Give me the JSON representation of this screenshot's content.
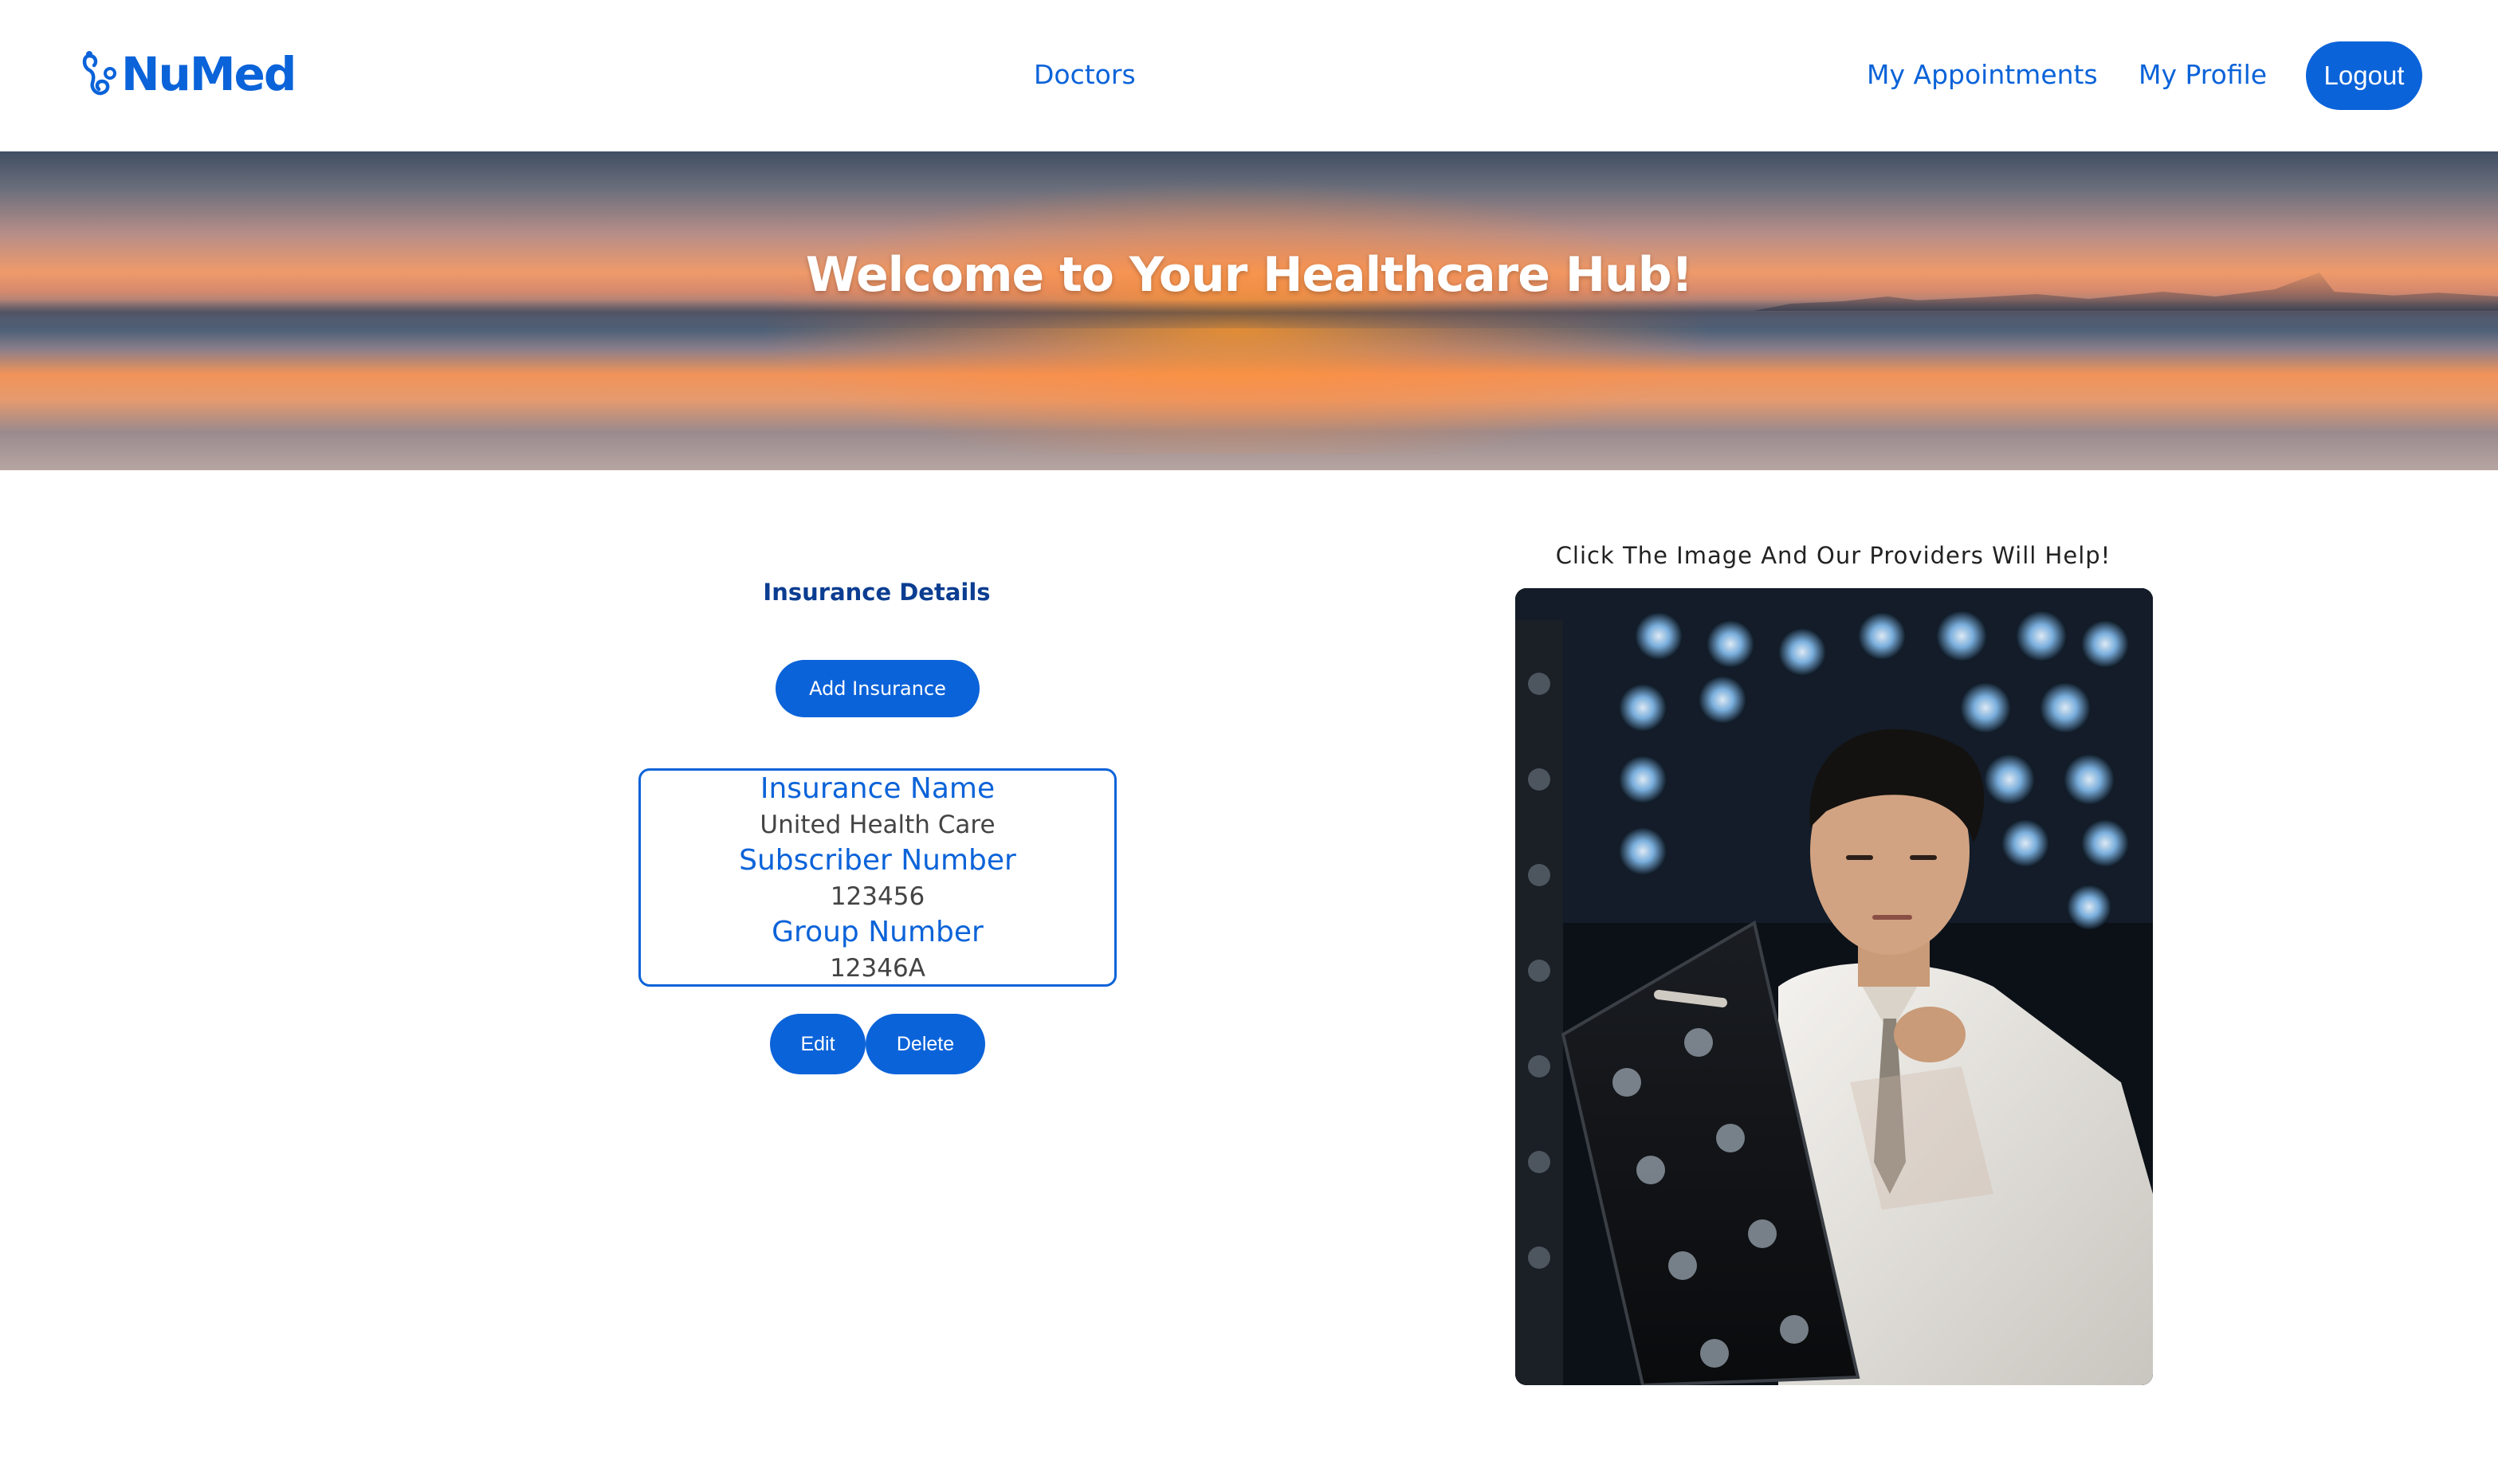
{
  "brand": {
    "name": "NuMed",
    "accent_color": "#0b63d9",
    "logo_icon": "stethoscope-icon"
  },
  "nav": {
    "doctors": "Doctors",
    "my_appointments": "My Appointments",
    "my_profile": "My Profile",
    "logout": "Logout"
  },
  "hero": {
    "title": "Welcome to Your Healthcare Hub!"
  },
  "insurance": {
    "heading": "Insurance Details",
    "add_button": "Add Insurance",
    "card": {
      "name_label": "Insurance Name",
      "name_value": "United Health Care",
      "subscriber_label": "Subscriber Number",
      "subscriber_value": "123456",
      "group_label": "Group Number",
      "group_value": "12346A"
    },
    "edit_button": "Edit",
    "delete_button": "Delete"
  },
  "help": {
    "caption": "Click The Image And Our Providers Will Help!"
  }
}
